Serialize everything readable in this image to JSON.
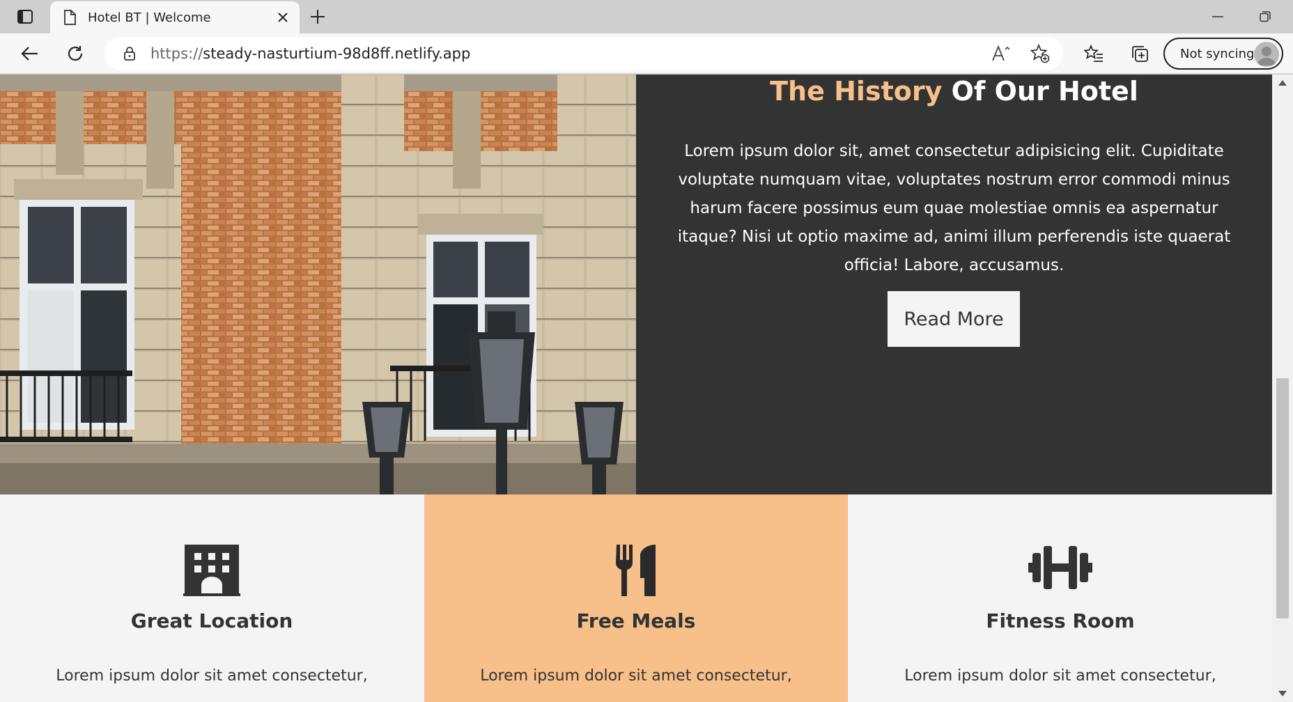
{
  "browser": {
    "tab_title": "Hotel BT | Welcome",
    "url_scheme": "https://",
    "url_host": "steady-nasturtium-98d8ff.netlify.app",
    "sync_label": "Not syncing",
    "icons": [
      "tab-actions-icon",
      "page-icon",
      "close-icon",
      "plus-icon",
      "minimize-icon",
      "restore-icon",
      "back-icon",
      "refresh-icon",
      "lock-icon",
      "read-aloud-icon",
      "add-favorite-icon",
      "favorites-icon",
      "collections-icon",
      "profile-avatar"
    ]
  },
  "history": {
    "title_accent": "The History",
    "title_rest": " Of Our Hotel",
    "text": "Lorem ipsum dolor sit, amet consectetur adipisicing elit. Cupiditate voluptate numquam vitae, voluptates nostrum error commodi minus harum facere possimus eum quae molestiae omnis ea aspernatur itaque? Nisi ut optio maxime ad, animi illum perferendis iste quaerat officia! Labore, accusamus.",
    "button_label": "Read More",
    "accent_color": "#f7bf89",
    "background_color": "#333333"
  },
  "features": [
    {
      "title": "Great Location",
      "text": "Lorem ipsum dolor sit amet consectetur,",
      "icon": "hotel-building-icon",
      "background": "#f4f4f4"
    },
    {
      "title": "Free Meals",
      "text": "Lorem ipsum dolor sit amet consectetur,",
      "icon": "fork-knife-icon",
      "background": "#f7bf89"
    },
    {
      "title": "Fitness Room",
      "text": "Lorem ipsum dolor sit amet consectetur,",
      "icon": "dumbbell-icon",
      "background": "#f4f4f4"
    }
  ]
}
